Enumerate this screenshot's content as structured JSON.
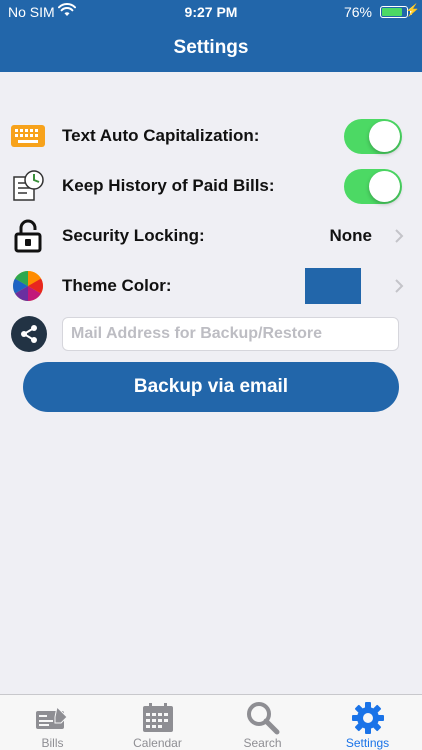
{
  "status_bar": {
    "carrier": "No SIM",
    "time": "9:27 PM",
    "battery_percent": "76%",
    "battery_level": 0.76
  },
  "nav": {
    "title": "Settings"
  },
  "settings": {
    "auto_cap": {
      "label": "Text Auto Capitalization:",
      "on": true
    },
    "history": {
      "label": "Keep History of Paid Bills:",
      "on": true
    },
    "security": {
      "label": "Security Locking:",
      "value": "None"
    },
    "theme": {
      "label": "Theme Color:",
      "color": "#2266aa"
    },
    "mail": {
      "placeholder": "Mail Address for Backup/Restore",
      "value": ""
    }
  },
  "backup_button": {
    "label": "Backup via email"
  },
  "tabs": [
    {
      "label": "Bills",
      "icon": "bills-icon",
      "active": false
    },
    {
      "label": "Calendar",
      "icon": "calendar-icon",
      "active": false
    },
    {
      "label": "Search",
      "icon": "search-icon",
      "active": false
    },
    {
      "label": "Settings",
      "icon": "gear-icon",
      "active": true
    }
  ],
  "colors": {
    "primary": "#2266aa",
    "switch_on": "#4cd964",
    "tab_active": "#1a73e8",
    "tab_inactive": "#8e8e93"
  }
}
